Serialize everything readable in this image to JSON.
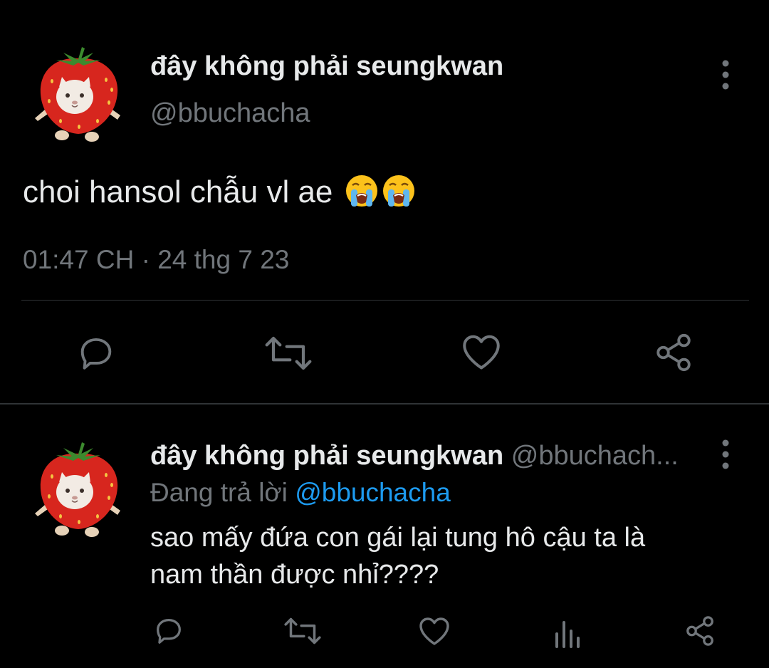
{
  "main_tweet": {
    "avatar_icon": "strawberry-cat-avatar",
    "display_name": "đây không phải seungkwan",
    "handle": "@bbuchacha",
    "text": "choi hansol chẫu vl ae",
    "emojis": [
      "loudly-crying-face",
      "loudly-crying-face"
    ],
    "time": "01:47 CH",
    "separator": "·",
    "date": "24 thg 7 23",
    "actions": [
      "reply-icon",
      "retweet-icon",
      "like-icon",
      "share-icon"
    ]
  },
  "reply_tweet": {
    "avatar_icon": "strawberry-cat-avatar",
    "display_name": "đây không phải seungkwan",
    "handle": "@bbuchach...",
    "replying_to_label": "Đang trả lời",
    "replying_to_handle": "@bbuchacha",
    "text_line1": "sao mấy đứa con gái lại tung hô cậu ta là",
    "text_line2": "nam thần được nhỉ????",
    "actions": [
      "reply-icon",
      "retweet-icon",
      "like-icon",
      "analytics-icon",
      "share-icon"
    ]
  },
  "colors": {
    "background": "#000000",
    "text_primary": "#e7e9ea",
    "text_secondary": "#71767b",
    "accent": "#1d9bf0",
    "divider": "#2f3336"
  }
}
